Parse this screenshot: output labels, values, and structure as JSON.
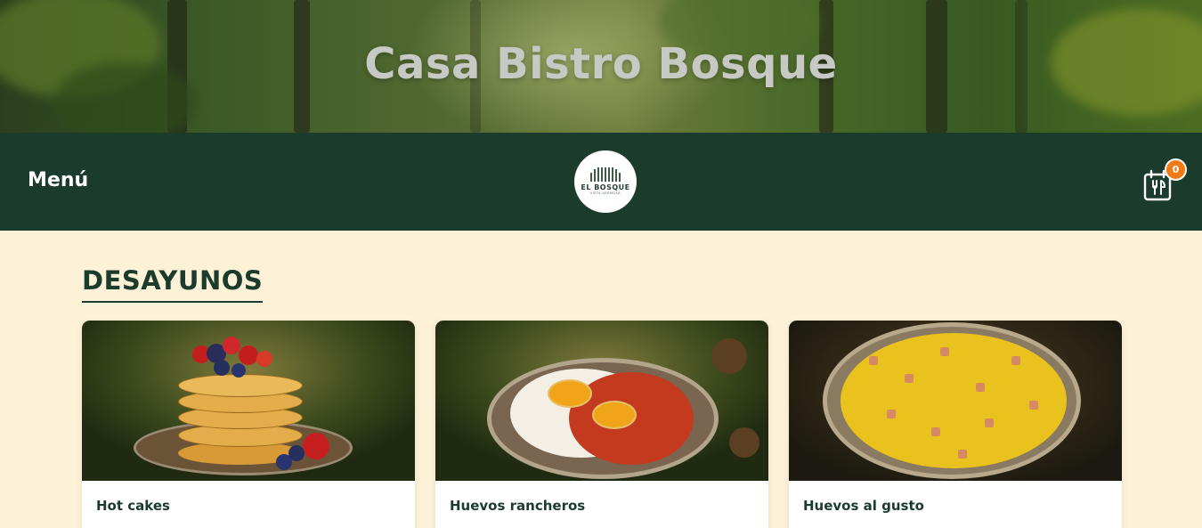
{
  "hero": {
    "title": "Casa Bistro Bosque"
  },
  "navbar": {
    "menu_label": "Menú",
    "logo": {
      "name": "EL BOSQUE",
      "subtitle": "VISTA HERMOSA"
    },
    "cart_count": "0",
    "cart_icon": "menu-cutlery-icon"
  },
  "section": {
    "title": "DESAYUNOS",
    "items": [
      {
        "name": "Hot cakes"
      },
      {
        "name": "Huevos rancheros"
      },
      {
        "name": "Huevos al gusto"
      }
    ]
  },
  "colors": {
    "navbar": "#1b3b2c",
    "background": "#fdf1d8",
    "badge": "#f07a15"
  }
}
